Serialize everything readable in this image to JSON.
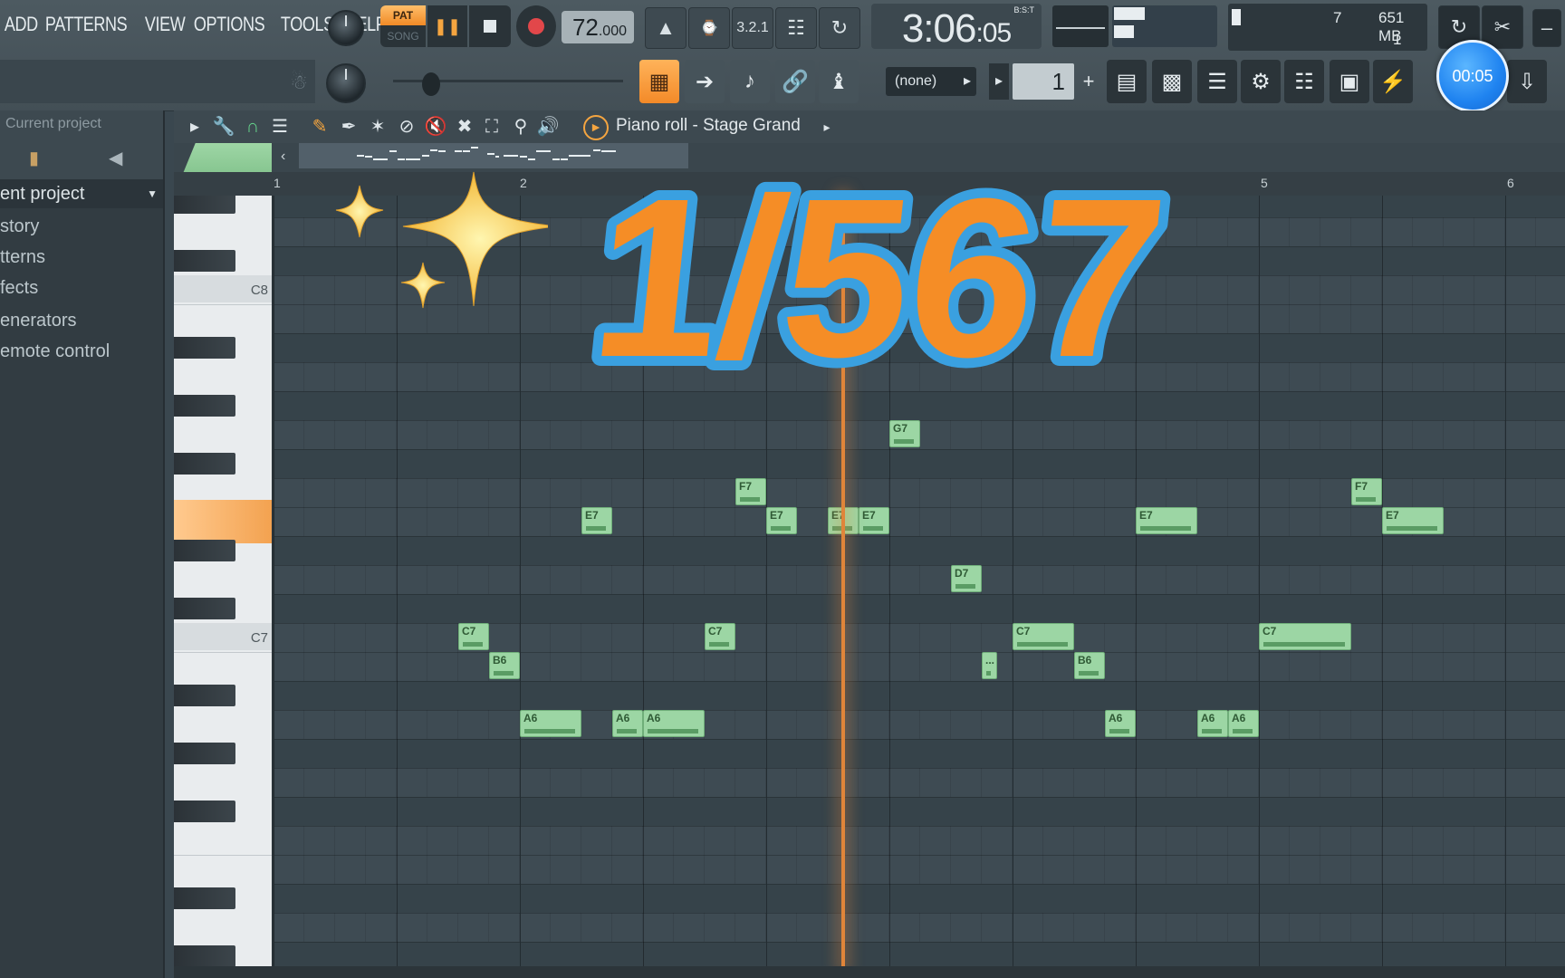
{
  "menu": [
    "ADD",
    "PATTERNS",
    "VIEW",
    "OPTIONS",
    "TOOLS",
    "HELP"
  ],
  "transport": {
    "pat_label": "PAT",
    "song_label": "SONG",
    "tempo_int": "72",
    "tempo_dec": ".000",
    "time_main": "3:06",
    "time_sub": ":05",
    "time_format": "B:S:T"
  },
  "cpu": {
    "voices": "7",
    "memory": "651 MB",
    "polyphony": "1"
  },
  "timer_badge": "00:05",
  "pattern_selector": "(none)",
  "snap_value": "1",
  "browser": {
    "header": "Current project",
    "items": [
      {
        "label": "ent project",
        "selected": true
      },
      {
        "label": "story",
        "selected": false
      },
      {
        "label": "tterns",
        "selected": false
      },
      {
        "label": "fects",
        "selected": false
      },
      {
        "label": "enerators",
        "selected": false
      },
      {
        "label": "emote control",
        "selected": false
      }
    ]
  },
  "piano_roll": {
    "title": "Piano roll - Stage Grand",
    "ruler": [
      "1",
      "2",
      "5",
      "6"
    ],
    "key_labels": [
      "C8",
      "C7"
    ],
    "highlighted_key": "E7",
    "notes": [
      {
        "label": "C7",
        "pitch": "C7",
        "start_step": 6.0,
        "length_steps": 1
      },
      {
        "label": "B6",
        "pitch": "B6",
        "start_step": 7.0,
        "length_steps": 1
      },
      {
        "label": "A6",
        "pitch": "A6",
        "start_step": 8.0,
        "length_steps": 2
      },
      {
        "label": "E7",
        "pitch": "E7",
        "start_step": 10.0,
        "length_steps": 1
      },
      {
        "label": "A6",
        "pitch": "A6",
        "start_step": 11.0,
        "length_steps": 1
      },
      {
        "label": "A6",
        "pitch": "A6",
        "start_step": 12.0,
        "length_steps": 2
      },
      {
        "label": "C7",
        "pitch": "C7",
        "start_step": 14.0,
        "length_steps": 1
      },
      {
        "label": "F7",
        "pitch": "F7",
        "start_step": 15.0,
        "length_steps": 1
      },
      {
        "label": "E7",
        "pitch": "E7",
        "start_step": 16.0,
        "length_steps": 1
      },
      {
        "label": "E7",
        "pitch": "E7",
        "start_step": 18.0,
        "length_steps": 1
      },
      {
        "label": "E7",
        "pitch": "E7",
        "start_step": 19.0,
        "length_steps": 1
      },
      {
        "label": "G7",
        "pitch": "G7",
        "start_step": 20.0,
        "length_steps": 1
      },
      {
        "label": "D7",
        "pitch": "D7",
        "start_step": 22.0,
        "length_steps": 1
      },
      {
        "label": "...",
        "pitch": "B6",
        "start_step": 23.0,
        "length_steps": 0.5
      },
      {
        "label": "C7",
        "pitch": "C7",
        "start_step": 24.0,
        "length_steps": 2
      },
      {
        "label": "B6",
        "pitch": "B6",
        "start_step": 26.0,
        "length_steps": 1
      },
      {
        "label": "A6",
        "pitch": "A6",
        "start_step": 27.0,
        "length_steps": 1
      },
      {
        "label": "E7",
        "pitch": "E7",
        "start_step": 28.0,
        "length_steps": 2
      },
      {
        "label": "A6",
        "pitch": "A6",
        "start_step": 30.0,
        "length_steps": 1
      },
      {
        "label": "A6",
        "pitch": "A6",
        "start_step": 31.0,
        "length_steps": 1
      },
      {
        "label": "C7",
        "pitch": "C7",
        "start_step": 32.0,
        "length_steps": 3
      },
      {
        "label": "F7",
        "pitch": "F7",
        "start_step": 35.0,
        "length_steps": 1
      },
      {
        "label": "E7",
        "pitch": "E7",
        "start_step": 36.0,
        "length_steps": 2
      }
    ],
    "playhead_step": 18.5
  },
  "overlay": {
    "counter_text": "1/567",
    "sparkle_icon": "sparkles-icon"
  },
  "colors": {
    "accent_orange": "#f5903a",
    "note_green": "#9cd6a4",
    "overlay_fill": "#f58d26",
    "overlay_outline": "#3aa0e0",
    "timer_blue": "#1f83f0"
  }
}
